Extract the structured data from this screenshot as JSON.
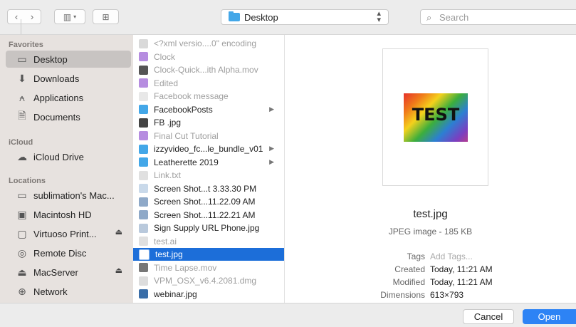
{
  "toolbar": {
    "back_icon": "chevron-left",
    "forward_icon": "chevron-right",
    "view_icon": "column-view",
    "newfolder_icon": "new-folder",
    "path_label": "Desktop",
    "search_placeholder": "Search"
  },
  "sidebar": {
    "favorites_header": "Favorites",
    "favorites": [
      {
        "label": "Desktop",
        "icon": "desktop-icon",
        "glyph": "▭",
        "selected": true
      },
      {
        "label": "Downloads",
        "icon": "downloads-icon",
        "glyph": "⬇"
      },
      {
        "label": "Applications",
        "icon": "applications-icon",
        "glyph": "⍲"
      },
      {
        "label": "Documents",
        "icon": "documents-icon",
        "glyph": "🗎"
      }
    ],
    "icloud_header": "iCloud",
    "icloud": [
      {
        "label": "iCloud Drive",
        "icon": "cloud-icon",
        "glyph": "☁"
      }
    ],
    "locations_header": "Locations",
    "locations": [
      {
        "label": "sublimation's Mac...",
        "icon": "computer-icon",
        "glyph": "▭"
      },
      {
        "label": "Macintosh HD",
        "icon": "disk-icon",
        "glyph": "▣"
      },
      {
        "label": "Virtuoso Print...",
        "icon": "disk-icon",
        "glyph": "▢",
        "eject": true
      },
      {
        "label": "Remote Disc",
        "icon": "disc-icon",
        "glyph": "◎"
      },
      {
        "label": "MacServer",
        "icon": "server-icon",
        "glyph": "⏏",
        "eject": true
      },
      {
        "label": "Network",
        "icon": "network-icon",
        "glyph": "⊕"
      }
    ]
  },
  "files": [
    {
      "name": "<?xml versio....0\" encoding",
      "dim": true,
      "color": "#d9d9d9"
    },
    {
      "name": "Clock",
      "dim": true,
      "color": "#b68de0"
    },
    {
      "name": "Clock-Quick...ith Alpha.mov",
      "dim": true,
      "color": "#555555"
    },
    {
      "name": "Edited",
      "dim": true,
      "color": "#b68de0"
    },
    {
      "name": "Facebook message",
      "dim": true,
      "color": "#e8e8e8"
    },
    {
      "name": "FacebookPosts",
      "folder": true,
      "color": "#43a7e8"
    },
    {
      "name": "FB .jpg",
      "color": "#444444"
    },
    {
      "name": "Final Cut Tutorial",
      "dim": true,
      "color": "#b68de0"
    },
    {
      "name": "izzyvideo_fc...le_bundle_v01",
      "folder": true,
      "color": "#43a7e8"
    },
    {
      "name": "Leatherette 2019",
      "folder": true,
      "color": "#43a7e8"
    },
    {
      "name": "Link.txt",
      "dim": true,
      "color": "#e0e0e0"
    },
    {
      "name": "Screen Shot...t 3.33.30 PM",
      "color": "#c9d9ea"
    },
    {
      "name": "Screen Shot...11.22.09 AM",
      "color": "#8fa9c8"
    },
    {
      "name": "Screen Shot...11.22.21 AM",
      "color": "#8fa9c8"
    },
    {
      "name": "Sign Supply URL Phone.jpg",
      "color": "#b9c9dc"
    },
    {
      "name": "test.ai",
      "dim": true,
      "color": "#e0e0e0"
    },
    {
      "name": "test.jpg",
      "selected": true,
      "color": "#ffffff"
    },
    {
      "name": "Time Lapse.mov",
      "dim": true,
      "color": "#777777"
    },
    {
      "name": "VPM_OSX_v6.4.2081.dmg",
      "dim": true,
      "color": "#dddddd"
    },
    {
      "name": "webinar.jpg",
      "color": "#3a6ea8"
    }
  ],
  "preview": {
    "image_text": "TEST",
    "name": "test.jpg",
    "kind": "JPEG image - 185 KB",
    "meta": [
      {
        "key": "Tags",
        "value": "Add Tags...",
        "dim": true
      },
      {
        "key": "Created",
        "value": "Today, 11:21 AM"
      },
      {
        "key": "Modified",
        "value": "Today, 11:21 AM"
      },
      {
        "key": "Dimensions",
        "value": "613×793"
      }
    ]
  },
  "buttons": {
    "cancel": "Cancel",
    "open": "Open"
  },
  "colors": {
    "accent": "#1c6ed9",
    "open_button": "#2d83f5",
    "sidebar_bg": "#e7e2df"
  }
}
